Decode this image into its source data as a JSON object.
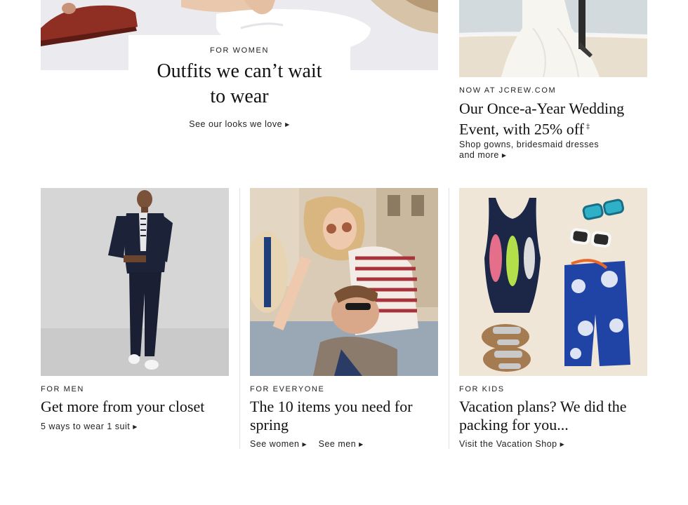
{
  "hero_left": {
    "eyebrow": "FOR WOMEN",
    "headline_line1": "Outfits we can’t wait",
    "headline_line2": "to wear",
    "link": "See our looks we love"
  },
  "hero_right": {
    "eyebrow": "NOW AT JCREW.COM",
    "headline_line1": "Our Once-a-Year Wedding",
    "headline_line2": "Event, with 25% off",
    "footnote_mark": "‡",
    "link_line1": "Shop gowns, bridesmaid dresses",
    "link_line2": "and more"
  },
  "tiles": [
    {
      "eyebrow": "FOR MEN",
      "headline_line1": "Get more from your closet",
      "headline_line2": "",
      "links": [
        "5 ways to wear 1 suit"
      ]
    },
    {
      "eyebrow": "FOR EVERYONE",
      "headline_line1": "The 10 items you need for",
      "headline_line2": "spring",
      "links": [
        "See women",
        "See men"
      ]
    },
    {
      "eyebrow": "FOR KIDS",
      "headline_line1": "Vacation plans? We did the",
      "headline_line2": "packing for you...",
      "links": [
        "Visit the Vacation Shop"
      ]
    }
  ],
  "colors": {
    "text": "#111111",
    "divider": "#e3e3e3",
    "men_bg": "#d8d8d8",
    "kids_bg": "#efe6d8",
    "swim_navy": "#1c2747"
  }
}
